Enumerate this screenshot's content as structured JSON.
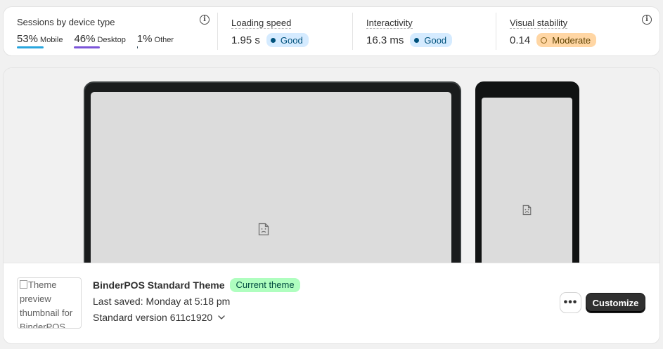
{
  "metrics": {
    "sessions": {
      "title": "Sessions by device type",
      "items": [
        {
          "pct": "53%",
          "label": "Mobile",
          "color": "#29a6de",
          "share": 0.53
        },
        {
          "pct": "46%",
          "label": "Desktop",
          "color": "#7c55d9",
          "share": 0.46
        },
        {
          "pct": "1%",
          "label": "Other",
          "color": "#2f4858",
          "share": 0.01
        }
      ]
    },
    "loading_speed": {
      "title": "Loading speed",
      "value": "1.95 s",
      "status": "Good"
    },
    "interactivity": {
      "title": "Interactivity",
      "value": "16.3 ms",
      "status": "Good"
    },
    "visual_stability": {
      "title": "Visual stability",
      "value": "0.14",
      "status": "Moderate"
    },
    "info_icon": "info-icon"
  },
  "theme": {
    "thumbnail_alt": "Theme preview thumbnail for BinderPOS",
    "name": "BinderPOS Standard Theme",
    "status_badge": "Current theme",
    "last_saved": "Last saved: Monday at 5:18 pm",
    "version": "Standard version 611c1920",
    "more_actions_icon": "ellipsis-icon",
    "customize_label": "Customize"
  },
  "colors": {
    "good_bg": "#d5ebff",
    "moderate_bg": "#ffd6a4",
    "current_badge_bg": "#affebf",
    "primary_button": "#303030"
  }
}
